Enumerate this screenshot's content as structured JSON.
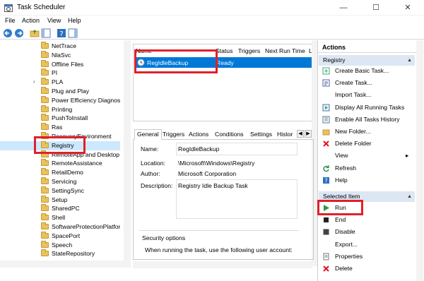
{
  "window": {
    "title": "Task Scheduler",
    "minimize": "—",
    "maximize": "☐",
    "close": "✕"
  },
  "menu": [
    "File",
    "Action",
    "View",
    "Help"
  ],
  "tree": {
    "items": [
      {
        "label": "NetTrace"
      },
      {
        "label": "NlaSvc"
      },
      {
        "label": "Offline Files"
      },
      {
        "label": "PI"
      },
      {
        "label": "PLA",
        "expandable": true
      },
      {
        "label": "Plug and Play"
      },
      {
        "label": "Power Efficiency Diagnost"
      },
      {
        "label": "Printing"
      },
      {
        "label": "PushToInstall"
      },
      {
        "label": "Ras"
      },
      {
        "label": "RecoveryEnvironment"
      },
      {
        "label": "Registry",
        "selected": true
      },
      {
        "label": "RemoteApp and Desktop"
      },
      {
        "label": "RemoteAssistance"
      },
      {
        "label": "RetailDemo"
      },
      {
        "label": "Servicing"
      },
      {
        "label": "SettingSync"
      },
      {
        "label": "Setup"
      },
      {
        "label": "SharedPC"
      },
      {
        "label": "Shell"
      },
      {
        "label": "SoftwareProtectionPlatfor"
      },
      {
        "label": "SpacePort"
      },
      {
        "label": "Speech"
      },
      {
        "label": "StateRepository"
      }
    ],
    "expander": "›"
  },
  "task_list": {
    "columns": [
      "Name",
      "Status",
      "Triggers",
      "Next Run Time",
      "L"
    ],
    "rows": [
      {
        "name": "RegIdleBackup",
        "status": "Ready"
      }
    ]
  },
  "tabs": [
    "General",
    "Triggers",
    "Actions",
    "Conditions",
    "Settings",
    "Histor"
  ],
  "general": {
    "name_label": "Name:",
    "name_value": "RegIdleBackup",
    "location_label": "Location:",
    "location_value": "\\Microsoft\\Windows\\Registry",
    "author_label": "Author:",
    "author_value": "Microsoft Corporation",
    "description_label": "Description:",
    "description_value": "Registry Idle Backup Task",
    "security_title": "Security options",
    "security_text": "When running the task, use the following user account:"
  },
  "actions_panel": {
    "header": "Actions",
    "section1": "Registry",
    "items1": [
      {
        "label": "Create Basic Task...",
        "icon": "create-basic-task-icon"
      },
      {
        "label": "Create Task...",
        "icon": "create-task-icon"
      },
      {
        "label": "Import Task...",
        "icon": ""
      },
      {
        "label": "Display All Running Tasks",
        "icon": "running-tasks-icon"
      },
      {
        "label": "Enable All Tasks History",
        "icon": "history-icon"
      },
      {
        "label": "New Folder...",
        "icon": "folder-icon"
      },
      {
        "label": "Delete Folder",
        "icon": "delete-icon"
      },
      {
        "label": "View",
        "icon": "",
        "submenu": true
      },
      {
        "label": "Refresh",
        "icon": "refresh-icon"
      },
      {
        "label": "Help",
        "icon": "help-icon"
      }
    ],
    "section2": "Selected Item",
    "items2": [
      {
        "label": "Run",
        "icon": "run-icon"
      },
      {
        "label": "End",
        "icon": "end-icon"
      },
      {
        "label": "Disable",
        "icon": "disable-icon"
      },
      {
        "label": "Export...",
        "icon": ""
      },
      {
        "label": "Properties",
        "icon": "properties-icon"
      },
      {
        "label": "Delete",
        "icon": "delete-icon"
      }
    ]
  },
  "colors": {
    "selection": "#0078d7",
    "tree_selection": "#cce8ff",
    "highlight": "#e0202a",
    "section_bg": "#dde6f3"
  }
}
